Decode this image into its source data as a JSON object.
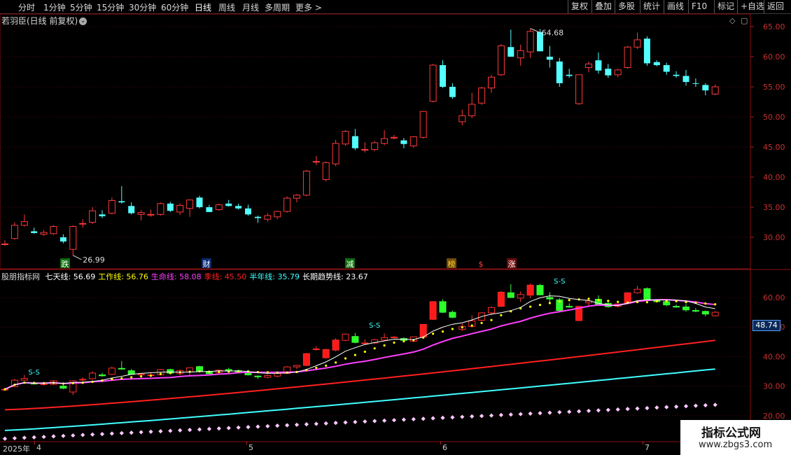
{
  "topbar": {
    "periods": [
      "分时",
      "1分钟",
      "5分钟",
      "15分钟",
      "30分钟",
      "60分钟",
      "日线",
      "周线",
      "月线",
      "多周期",
      "更多 >"
    ],
    "active_period": "日线",
    "right_buttons": [
      "复权",
      "叠加",
      "多股",
      "统计",
      "画线",
      "F10",
      "标记",
      "+自选",
      "返回"
    ]
  },
  "main_chart": {
    "title": "若羽臣(日线 前复权)",
    "max_label": "64.68",
    "min_label": "26.99",
    "y_ticks": [
      "65.00",
      "60.00",
      "55.00",
      "50.00",
      "45.00",
      "40.00",
      "35.00",
      "30.00"
    ],
    "event_labels": [
      "跌",
      "财",
      "减",
      "榜",
      "$",
      "涨"
    ]
  },
  "indicator": {
    "name": "股朋指标网",
    "lines": [
      {
        "label": "七天线:",
        "value": "56.69",
        "color": "#ffffff"
      },
      {
        "label": "工作线:",
        "value": "56.76",
        "color": "#ffff00"
      },
      {
        "label": "生命线:",
        "value": "58.08",
        "color": "#ff40ff"
      },
      {
        "label": "季线:",
        "value": "45.50",
        "color": "#ff2020"
      },
      {
        "label": "半年线:",
        "value": "35.79",
        "color": "#40ffff"
      },
      {
        "label": "长期趋势线:",
        "value": "23.67",
        "color": "#ffffff"
      }
    ],
    "y_ticks": [
      "60.00",
      "50.00",
      "40.00",
      "30.00",
      "20.00"
    ],
    "current_value": "48.74",
    "ss_label": "S-S"
  },
  "date_axis": [
    "2025年",
    "4",
    "5",
    "6",
    "7"
  ],
  "watermark": {
    "title": "指标公式网",
    "url": "www.zbgs3.com"
  },
  "chart_data": {
    "type": "candlestick",
    "title": "若羽臣(日线 前复权)",
    "ylim": [
      25,
      66
    ],
    "candles": [
      [
        28.8,
        29.5,
        28.6,
        28.9
      ],
      [
        29.8,
        32.5,
        29.6,
        32.0
      ],
      [
        32.0,
        33.8,
        31.8,
        32.6
      ],
      [
        31.0,
        31.6,
        30.6,
        30.7
      ],
      [
        30.5,
        31.2,
        30.2,
        30.8
      ],
      [
        30.6,
        32.0,
        30.4,
        31.8
      ],
      [
        30.0,
        30.5,
        29.0,
        29.3
      ],
      [
        28.0,
        32.0,
        27.0,
        31.8
      ],
      [
        32.2,
        33.0,
        31.6,
        32.3
      ],
      [
        32.5,
        35.0,
        32.2,
        34.4
      ],
      [
        33.8,
        34.5,
        33.2,
        33.5
      ],
      [
        34.0,
        36.6,
        33.8,
        36.1
      ],
      [
        36.0,
        38.5,
        35.6,
        35.8
      ],
      [
        35.2,
        35.8,
        33.8,
        34.0
      ],
      [
        33.8,
        34.5,
        32.8,
        34.1
      ],
      [
        33.8,
        34.6,
        33.4,
        33.8
      ],
      [
        33.8,
        35.8,
        33.6,
        35.6
      ],
      [
        35.6,
        35.9,
        34.2,
        34.4
      ],
      [
        34.2,
        35.6,
        33.7,
        35.3
      ],
      [
        34.8,
        36.3,
        33.4,
        36.2
      ],
      [
        36.6,
        36.9,
        34.8,
        35.0
      ],
      [
        35.0,
        35.4,
        34.2,
        34.2
      ],
      [
        34.6,
        35.6,
        34.4,
        35.4
      ],
      [
        35.6,
        36.2,
        35.1,
        35.2
      ],
      [
        35.2,
        35.6,
        34.6,
        34.8
      ],
      [
        34.8,
        35.4,
        33.6,
        33.8
      ],
      [
        33.4,
        33.6,
        32.4,
        33.2
      ],
      [
        33.0,
        34.0,
        32.6,
        33.6
      ],
      [
        33.4,
        34.4,
        33.0,
        34.3
      ],
      [
        34.3,
        36.8,
        34.1,
        36.5
      ],
      [
        36.5,
        37.2,
        35.8,
        37.0
      ],
      [
        37.0,
        41.2,
        36.8,
        41.0
      ],
      [
        42.6,
        43.5,
        42.0,
        42.6
      ],
      [
        39.6,
        42.6,
        39.3,
        42.4
      ],
      [
        42.2,
        46.2,
        41.8,
        45.6
      ],
      [
        45.5,
        47.8,
        45.2,
        47.6
      ],
      [
        46.8,
        48.0,
        44.5,
        44.8
      ],
      [
        44.6,
        45.8,
        44.1,
        44.6
      ],
      [
        44.6,
        46.0,
        44.3,
        45.7
      ],
      [
        45.6,
        47.8,
        45.3,
        46.4
      ],
      [
        46.6,
        47.0,
        46.3,
        46.6
      ],
      [
        46.1,
        46.5,
        44.8,
        45.5
      ],
      [
        45.2,
        46.8,
        44.9,
        46.7
      ],
      [
        46.6,
        51.0,
        46.4,
        50.9
      ],
      [
        52.6,
        58.8,
        52.4,
        58.6
      ],
      [
        58.6,
        59.4,
        54.8,
        55.0
      ],
      [
        55.0,
        55.6,
        53.0,
        53.3
      ],
      [
        49.2,
        51.2,
        48.6,
        50.2
      ],
      [
        50.2,
        54.0,
        49.8,
        52.1
      ],
      [
        52.3,
        55.0,
        52.0,
        54.8
      ],
      [
        54.8,
        57.0,
        54.0,
        56.6
      ],
      [
        57.0,
        62.1,
        56.8,
        61.8
      ],
      [
        61.6,
        64.5,
        60.7,
        60.0
      ],
      [
        59.8,
        62.0,
        58.5,
        61.0
      ],
      [
        60.8,
        64.7,
        59.8,
        64.2
      ],
      [
        64.1,
        64.6,
        60.9,
        60.9
      ],
      [
        60.0,
        61.8,
        58.2,
        59.5
      ],
      [
        59.2,
        59.8,
        55.0,
        55.6
      ],
      [
        57.0,
        58.0,
        56.5,
        56.8
      ],
      [
        52.2,
        57.0,
        52.0,
        57.0
      ],
      [
        58.2,
        59.2,
        57.4,
        58.8
      ],
      [
        59.4,
        60.7,
        57.2,
        57.7
      ],
      [
        58.0,
        58.8,
        56.5,
        56.9
      ],
      [
        57.0,
        58.0,
        56.6,
        57.8
      ],
      [
        58.2,
        61.8,
        58.0,
        61.6
      ],
      [
        61.6,
        64.0,
        61.3,
        62.8
      ],
      [
        63.0,
        63.4,
        58.5,
        58.9
      ],
      [
        59.1,
        59.4,
        58.4,
        58.6
      ],
      [
        58.6,
        59.0,
        57.0,
        57.5
      ],
      [
        57.0,
        57.6,
        56.5,
        56.8
      ],
      [
        56.8,
        57.8,
        55.2,
        55.8
      ],
      [
        55.6,
        56.4,
        55.0,
        55.5
      ],
      [
        55.3,
        55.6,
        53.6,
        54.4
      ],
      [
        53.8,
        55.4,
        53.6,
        55.0
      ]
    ],
    "indicator_series": [
      {
        "name": "七天线",
        "last": 56.69
      },
      {
        "name": "工作线",
        "last": 56.76
      },
      {
        "name": "生命线",
        "last": 58.08
      },
      {
        "name": "季线",
        "last": 45.5
      },
      {
        "name": "半年线",
        "last": 35.79
      },
      {
        "name": "长期趋势线",
        "last": 23.67
      }
    ]
  }
}
